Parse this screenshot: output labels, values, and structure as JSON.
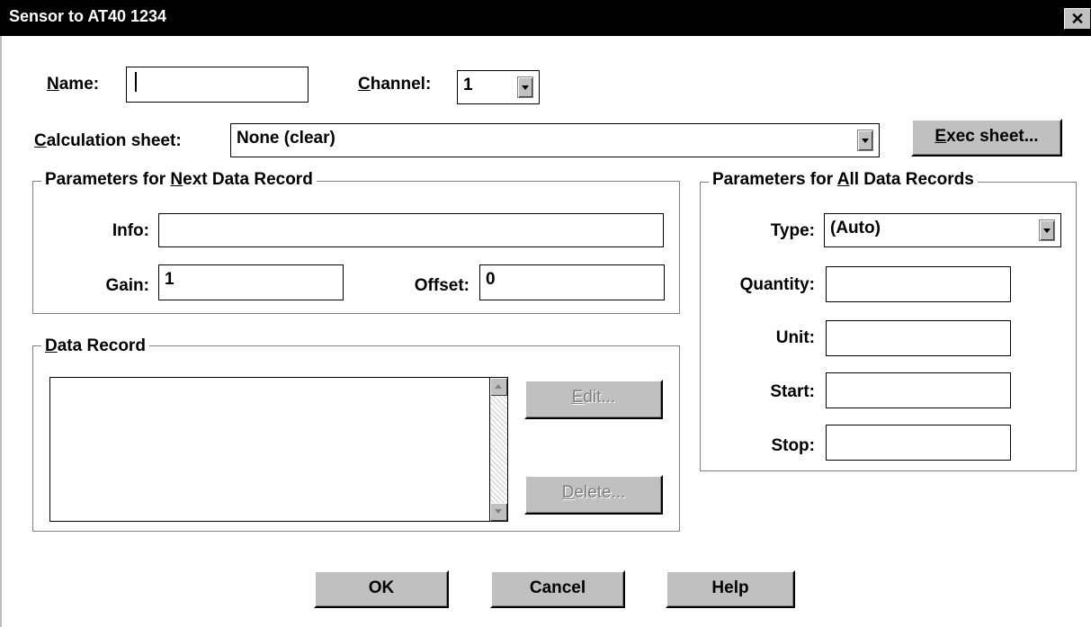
{
  "window": {
    "title": "Sensor to AT40 1234",
    "close_glyph": "✕"
  },
  "name": {
    "label_key": "N",
    "label_rest": "ame:",
    "value": ""
  },
  "channel": {
    "label_key": "C",
    "label_rest": "hannel:",
    "value": "1"
  },
  "calculation": {
    "label_key": "C",
    "label_rest": "alculation sheet:",
    "value": "None (clear)"
  },
  "exec_button": {
    "key": "E",
    "rest": "xec sheet..."
  },
  "next_record": {
    "title_pre": "Parameters for ",
    "title_key": "N",
    "title_rest": "ext Data Record",
    "info_label": "Info:",
    "info_value": "",
    "gain_label": "Gain:",
    "gain_value": "1",
    "offset_label": "Offset:",
    "offset_value": "0"
  },
  "all_records": {
    "title_pre": "Parameters for ",
    "title_key": "A",
    "title_rest": "ll Data Records",
    "type_label": "Type:",
    "type_value": "(Auto)",
    "quantity_label": "Quantity:",
    "quantity_value": "",
    "unit_label": "Unit:",
    "unit_value": "",
    "start_label": "Start:",
    "start_value": "",
    "stop_label": "Stop:",
    "stop_value": ""
  },
  "data_record": {
    "title_key": "D",
    "title_rest": "ata Record",
    "edit_key": "E",
    "edit_rest": "dit...",
    "delete_key": "D",
    "delete_rest": "elete..."
  },
  "footer": {
    "ok": "OK",
    "cancel": "Cancel",
    "help": "Help"
  }
}
